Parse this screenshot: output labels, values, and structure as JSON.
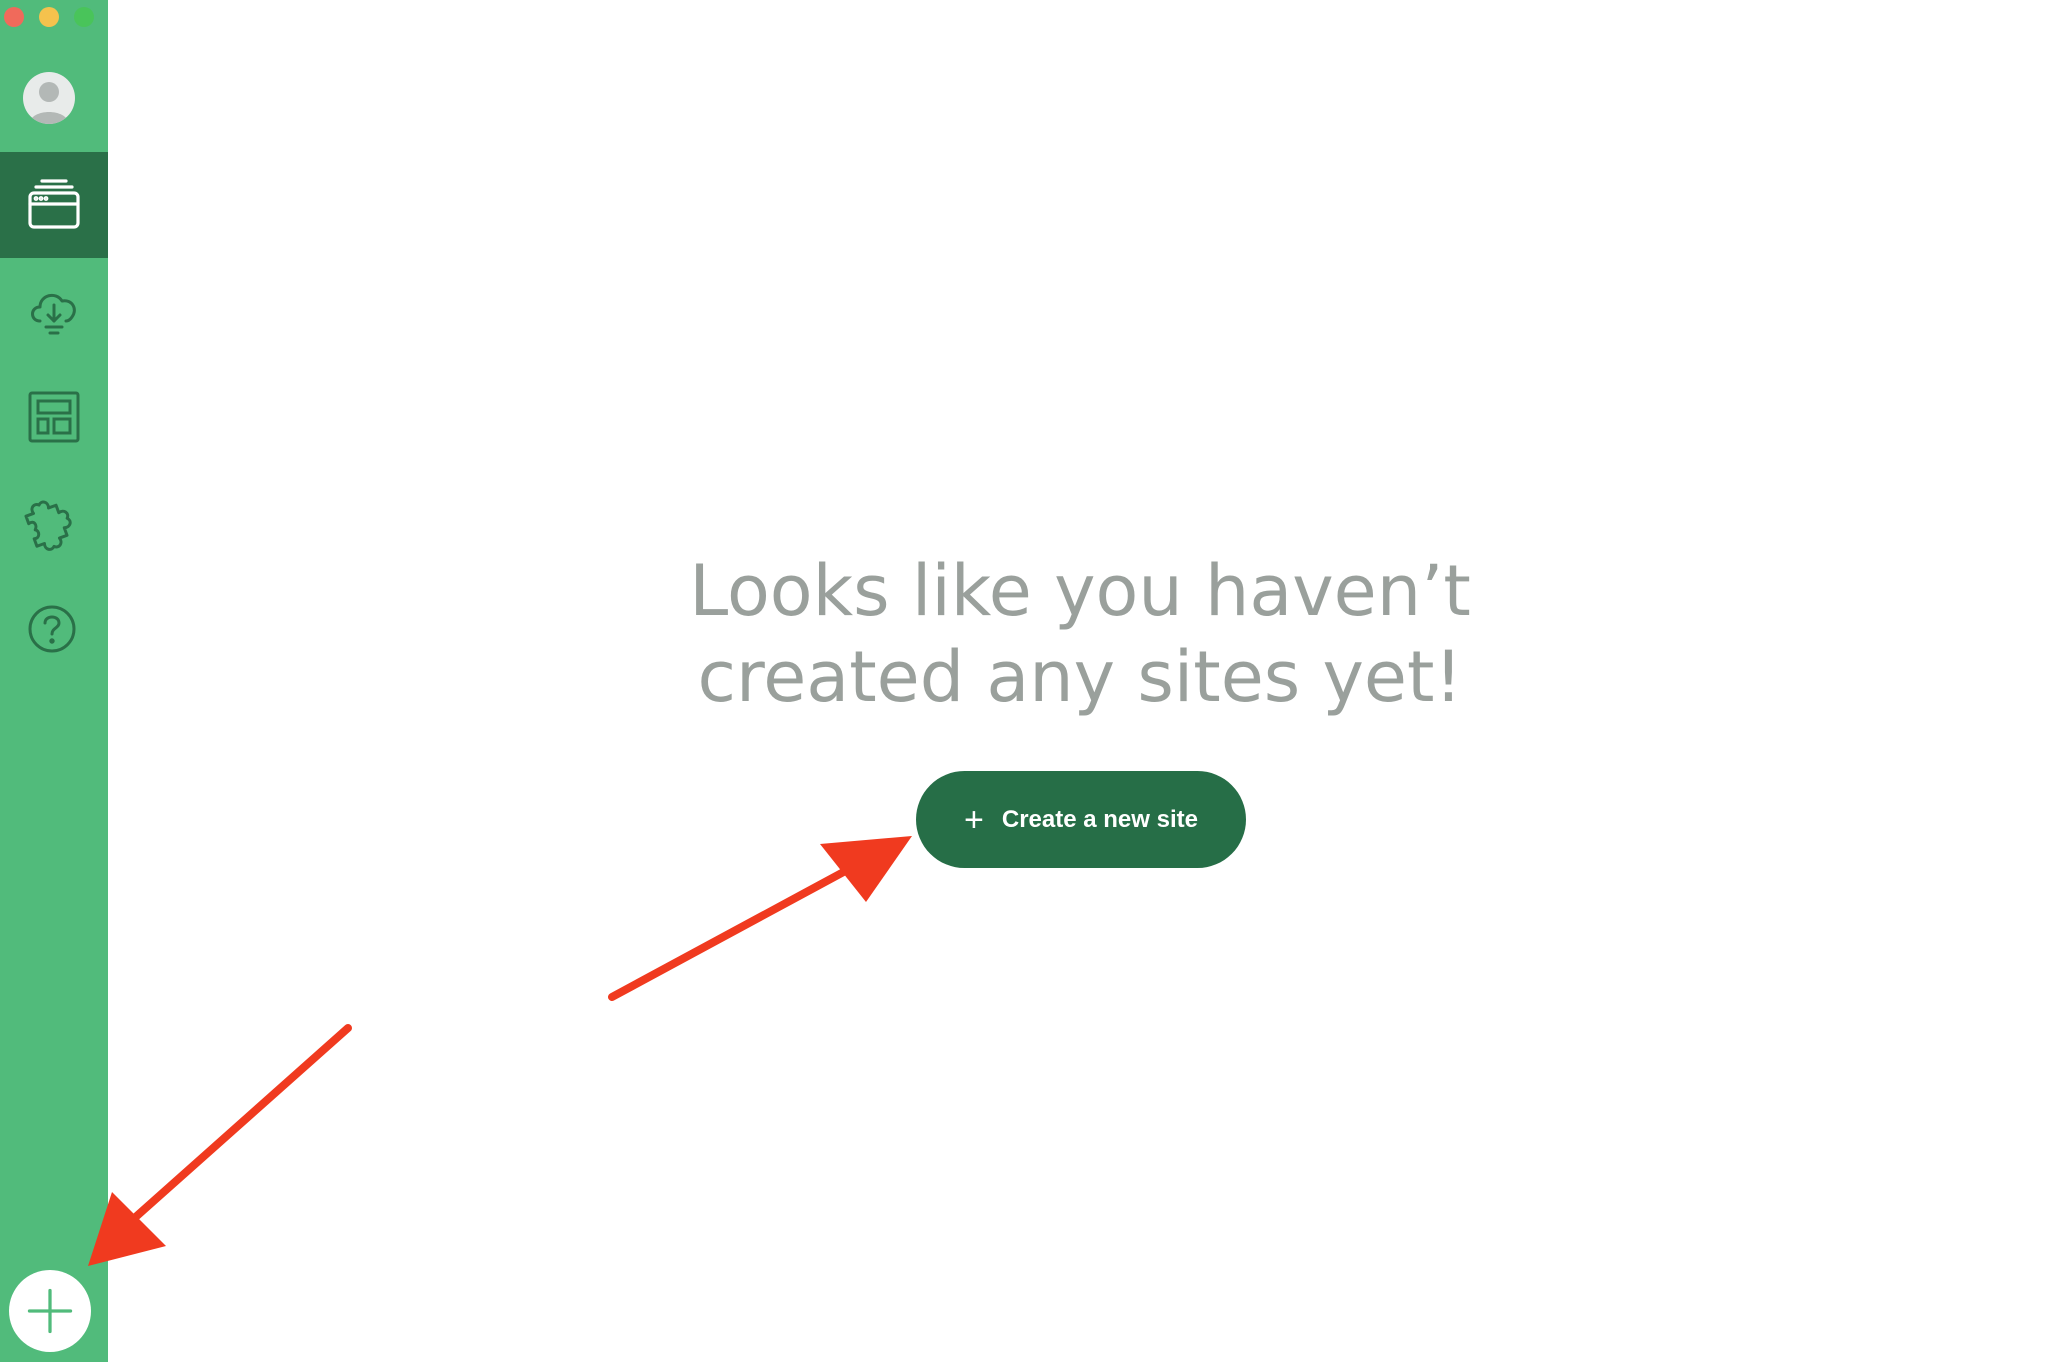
{
  "window": {
    "controls": [
      "close",
      "minimize",
      "zoom"
    ]
  },
  "sidebar": {
    "accent_color": "#51bb7b",
    "active_color": "#2a7048",
    "items": [
      {
        "id": "sites",
        "icon": "browser-window-icon",
        "active": true
      },
      {
        "id": "connect",
        "icon": "cloud-sync-icon",
        "active": false
      },
      {
        "id": "blueprints",
        "icon": "layout-grid-icon",
        "active": false
      },
      {
        "id": "addons",
        "icon": "puzzle-piece-icon",
        "active": false
      },
      {
        "id": "help",
        "icon": "help-circle-icon",
        "active": false
      }
    ],
    "add_button_icon": "plus-icon"
  },
  "main": {
    "empty_message": "Looks like you haven’t created any sites yet!",
    "create_button_label": "Create a new site",
    "create_button_icon": "plus-icon"
  },
  "annotations": {
    "arrow_color": "#f03a1f"
  }
}
